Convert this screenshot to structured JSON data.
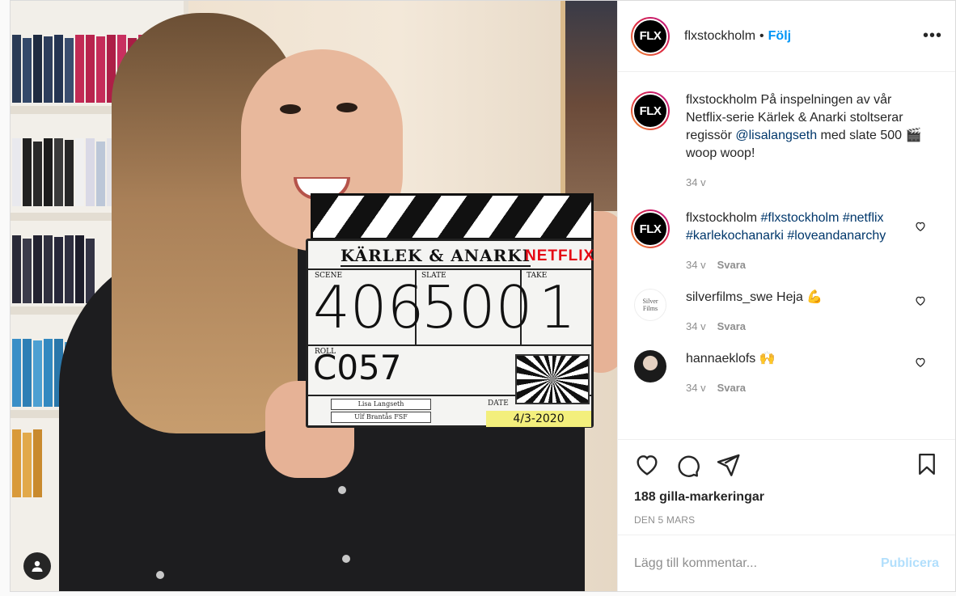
{
  "post": {
    "username": "flxstockholm",
    "follow_label": "Följ",
    "separator": "•",
    "more_label": "•••",
    "avatar_text": "FLX"
  },
  "photo": {
    "slate_title": "KÄRLEK & ANARKI",
    "slate_brand": "NETFLIX",
    "scene_label": "SCENE",
    "slate_label": "SLATE",
    "take_label": "TAKE",
    "roll_label": "ROLL",
    "date_label": "DATE",
    "scene": "406",
    "slate": "500",
    "take": "1",
    "roll": "C057",
    "director": "Lisa Langseth",
    "dop": "Ulf Brantås FSF",
    "date": "4/3-2020"
  },
  "caption": {
    "username": "flxstockholm",
    "text_before": " På inspelningen av vår Netflix-serie Kärlek & Anarki stoltserar regissör ",
    "mention": "@lisalangseth",
    "text_after": " med slate 500 🎬 woop woop!",
    "time": "34 v"
  },
  "comments": [
    {
      "username": "flxstockholm",
      "hashtags": "#flxstockholm #netflix #karlekochanarki #loveandanarchy",
      "time": "34 v",
      "reply_label": "Svara",
      "avatar_text": "FLX"
    },
    {
      "username": "silverfilms_swe",
      "text": " Heja 💪",
      "time": "34 v",
      "reply_label": "Svara",
      "avatar_text": "Silver Films"
    },
    {
      "username": "hannaeklofs",
      "text": " 🙌",
      "time": "34 v",
      "reply_label": "Svara"
    }
  ],
  "actions": {
    "likes": "188 gilla-markeringar",
    "date": "DEN 5 MARS"
  },
  "add_comment": {
    "placeholder": "Lägg till kommentar...",
    "publish_label": "Publicera"
  },
  "colors": {
    "link": "#0095f6",
    "hashtag": "#00376b",
    "muted": "#8e8e8e",
    "publish_disabled": "#b2dffc"
  }
}
